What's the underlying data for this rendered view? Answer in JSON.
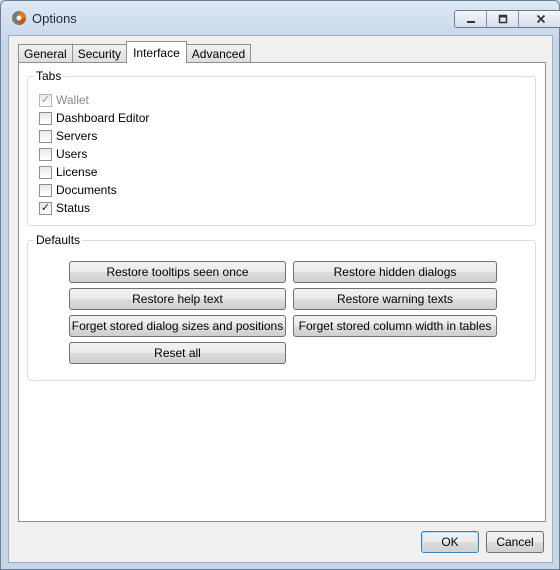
{
  "window": {
    "title": "Options",
    "controls": {
      "minimize": "minimize-icon",
      "restore": "restore-icon",
      "close": "close-icon"
    }
  },
  "tabs": [
    {
      "label": "General",
      "active": false
    },
    {
      "label": "Security",
      "active": false
    },
    {
      "label": "Interface",
      "active": true
    },
    {
      "label": "Advanced",
      "active": false
    }
  ],
  "tabs_group": {
    "label": "Tabs",
    "items": [
      {
        "label": "Wallet",
        "checked": true,
        "disabled": true
      },
      {
        "label": "Dashboard Editor",
        "checked": false,
        "disabled": false
      },
      {
        "label": "Servers",
        "checked": false,
        "disabled": false
      },
      {
        "label": "Users",
        "checked": false,
        "disabled": false
      },
      {
        "label": "License",
        "checked": false,
        "disabled": false
      },
      {
        "label": "Documents",
        "checked": false,
        "disabled": false
      },
      {
        "label": "Status",
        "checked": true,
        "disabled": false
      }
    ]
  },
  "defaults_group": {
    "label": "Defaults",
    "buttons": {
      "restore_tooltips": "Restore tooltips seen once",
      "restore_hidden_dialogs": "Restore hidden dialogs",
      "restore_help_text": "Restore help text",
      "restore_warning_texts": "Restore warning texts",
      "forget_dialog_sizes": "Forget stored dialog sizes and positions",
      "forget_column_width": "Forget stored column width in tables",
      "reset_all": "Reset all"
    }
  },
  "footer": {
    "ok": "OK",
    "cancel": "Cancel"
  },
  "colors": {
    "accent": "#3c7fb1",
    "disabled_text": "#8a8a8a",
    "window_frame": "#c6d6ea"
  }
}
